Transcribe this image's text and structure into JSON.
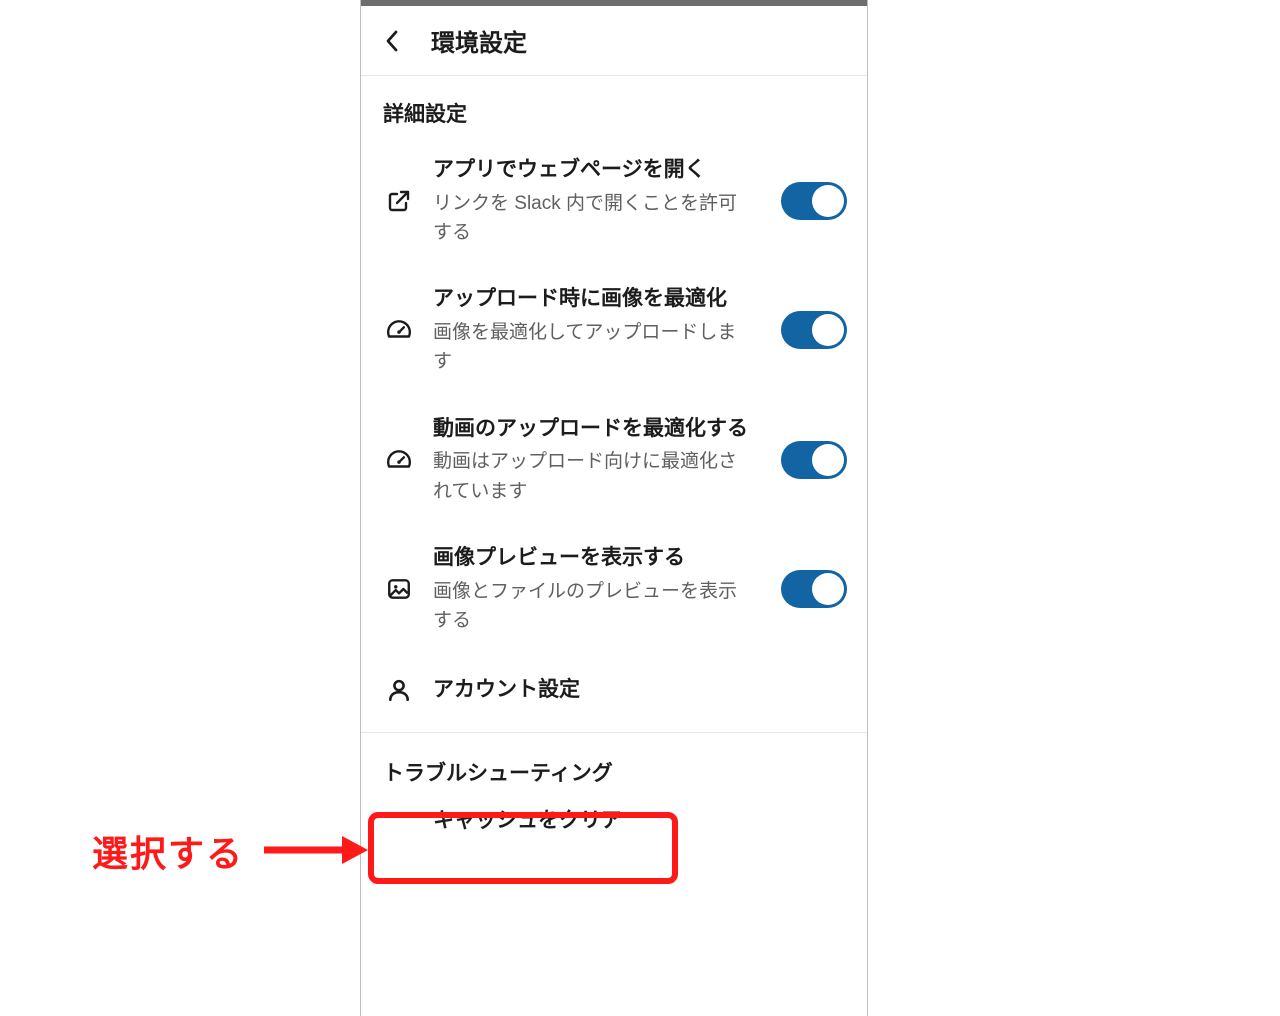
{
  "appbar": {
    "title": "環境設定"
  },
  "section": {
    "advanced": "詳細設定",
    "trouble": "トラブルシューティング"
  },
  "rows": {
    "open_links": {
      "title": "アプリでウェブページを開く",
      "sub": "リンクを Slack 内で開くことを許可する"
    },
    "opt_image": {
      "title": "アップロード時に画像を最適化",
      "sub": "画像を最適化してアップロードします"
    },
    "opt_video": {
      "title": "動画のアップロードを最適化する",
      "sub": "動画はアップロード向けに最適化されています"
    },
    "preview": {
      "title": "画像プレビューを表示する",
      "sub": "画像とファイルのプレビューを表示する"
    },
    "account": {
      "title": "アカウント設定"
    },
    "clear_cache": {
      "title": "キャッシュをクリア"
    }
  },
  "annotation": {
    "label": "選択する"
  },
  "colors": {
    "toggle_on": "#1264a3",
    "highlight": "#ff1a1a"
  }
}
